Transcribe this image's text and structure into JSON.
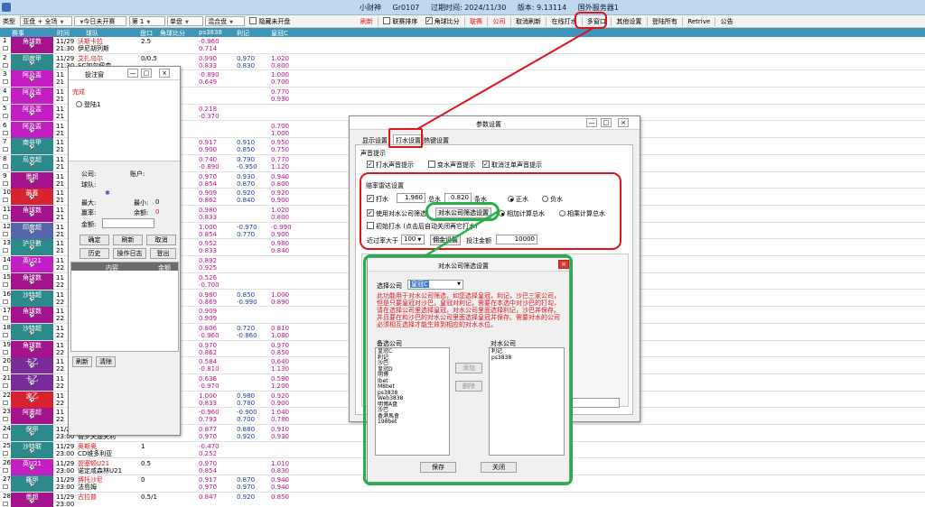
{
  "titlebar": {
    "app": "小财神",
    "user": "Gr0107",
    "expire": "过期时间: 2024/11/30",
    "version": "版本: 9.13114",
    "server": "国外服务器1"
  },
  "toolbar": {
    "type_label": "类型",
    "type_value": "亚盘 + 全场",
    "date_value": "今日未开赛",
    "page_value": "第 1",
    "single_value": "单盘",
    "mixed_value": "混合盘",
    "hide_label": "隐藏未开盘",
    "refresh": "刷新",
    "league_sort": "联赛排序",
    "compare": "角球比分",
    "league": "联赛",
    "company": "公司",
    "cancel_refresh": "取消刷新",
    "online_bet": "在线打水",
    "multi_window": "多窗口",
    "other_settings": "其他设置",
    "login_all": "登陆所有",
    "retrive": "Retrive",
    "notice": "公告"
  },
  "grid": {
    "headers": [
      "赛事",
      "时间",
      "球队",
      "盘口",
      "角球比分",
      "ps3838",
      "利记",
      "皇冠C"
    ],
    "rows": [
      {
        "num": "1",
        "league": "角球数",
        "date": "11/29",
        "time": "21:30",
        "team1": "沃斯卡拉",
        "team2": "伊尼胡列斯",
        "hdp": "2.5",
        "ps": [
          "-0.960",
          "0.714"
        ],
        "lj": [
          "",
          ""
        ],
        "hg": [
          "",
          ""
        ],
        "color": "#a3138c"
      },
      {
        "num": "2",
        "league": "印度甲",
        "date": "11/29",
        "time": "21:30",
        "team1": "艾扎乌尔",
        "team2": "SC加尔佩森",
        "hdp": "0/0.5",
        "ps": [
          "0.990",
          "0.833"
        ],
        "lj": [
          "0.970",
          "0.830"
        ],
        "hg": [
          "1.020",
          "0.800"
        ],
        "color": "#2d8a8a"
      },
      {
        "num": "3",
        "league": "阿及盃",
        "date": "11",
        "time": "21",
        "team1": "",
        "team2": "",
        "hdp": "",
        "ps": [
          "-0.890",
          "0.649"
        ],
        "lj": [
          "",
          ""
        ],
        "hg": [
          "1.000",
          "0.700"
        ],
        "color": "#c11fc2"
      },
      {
        "num": "4",
        "league": "阿及盃",
        "date": "11",
        "time": "21",
        "team1": "",
        "team2": "",
        "hdp": "",
        "ps": [
          "",
          ""
        ],
        "lj": [
          "",
          ""
        ],
        "hg": [
          "0.770",
          "0.930"
        ],
        "color": "#c11fc2"
      },
      {
        "num": "5",
        "league": "阿及盃",
        "date": "11",
        "time": "21",
        "team1": "",
        "team2": "",
        "hdp": "",
        "ps": [
          "0.218",
          "-0.370"
        ],
        "lj": [
          "",
          ""
        ],
        "hg": [
          "",
          ""
        ],
        "color": "#c11fc2"
      },
      {
        "num": "6",
        "league": "阿及盃",
        "date": "11",
        "time": "21",
        "team1": "",
        "team2": "",
        "hdp": "",
        "ps": [
          "",
          ""
        ],
        "lj": [
          "",
          ""
        ],
        "hg": [
          "0.700",
          "1.000"
        ],
        "color": "#c11fc2"
      },
      {
        "num": "7",
        "league": "南非甲",
        "date": "11",
        "time": "21",
        "team1": "",
        "team2": "",
        "hdp": "",
        "ps": [
          "0.917",
          "0.900"
        ],
        "lj": [
          "0.910",
          "0.850"
        ],
        "hg": [
          "0.950",
          "0.750"
        ],
        "color": "#2d8a8a"
      },
      {
        "num": "8",
        "league": "烏克超",
        "date": "11",
        "time": "21",
        "team1": "",
        "team2": "",
        "hdp": "",
        "ps": [
          "0.740",
          "-0.890"
        ],
        "lj": [
          "0.790",
          "-0.950"
        ],
        "hg": [
          "0.770",
          "1.120"
        ],
        "color": "#2d8a8a"
      },
      {
        "num": "9",
        "league": "墨超",
        "date": "11",
        "time": "21",
        "team1": "",
        "team2": "",
        "hdp": "",
        "ps": [
          "0.970",
          "0.854"
        ],
        "lj": [
          "0.930",
          "0.870"
        ],
        "hg": [
          "0.940",
          "0.800"
        ],
        "color": "#a3138c"
      },
      {
        "num": "10",
        "league": "最養",
        "date": "11",
        "time": "21",
        "team1": "",
        "team2": "",
        "hdp": "",
        "ps": [
          "0.909",
          "0.862"
        ],
        "lj": [
          "0.920",
          "0.840"
        ],
        "hg": [
          "0.920",
          "0.900"
        ],
        "color": "#d6232f"
      },
      {
        "num": "11",
        "league": "角球数",
        "date": "11",
        "time": "21",
        "team1": "",
        "team2": "",
        "hdp": "",
        "ps": [
          "0.980",
          "0.833"
        ],
        "lj": [
          "",
          ""
        ],
        "hg": [
          "1.020",
          "0.800"
        ],
        "color": "#a3138c"
      },
      {
        "num": "12",
        "league": "印度超",
        "date": "11",
        "time": "21",
        "team1": "",
        "team2": "",
        "hdp": "",
        "ps": [
          "1.000",
          "0.854"
        ],
        "lj": [
          "-0.970",
          "0.770"
        ],
        "hg": [
          "-0.990",
          "0.900"
        ],
        "color": "#5566aa"
      },
      {
        "num": "13",
        "league": "沪旦數",
        "date": "11",
        "time": "21",
        "team1": "",
        "team2": "",
        "hdp": "",
        "ps": [
          "0.952",
          "0.833"
        ],
        "lj": [
          "",
          ""
        ],
        "hg": [
          "0.980",
          "0.840"
        ],
        "color": "#2d8a8a"
      },
      {
        "num": "14",
        "league": "英U21",
        "date": "11",
        "time": "22",
        "team1": "",
        "team2": "",
        "hdp": "",
        "ps": [
          "0.892",
          "0.925"
        ],
        "lj": [
          "",
          ""
        ],
        "hg": [
          "",
          ""
        ],
        "color": "#c11fc2"
      },
      {
        "num": "15",
        "league": "角球数",
        "date": "11",
        "time": "22",
        "team1": "",
        "team2": "",
        "hdp": "",
        "ps": [
          "0.526",
          "-0.700"
        ],
        "lj": [
          "",
          ""
        ],
        "hg": [
          "",
          ""
        ],
        "color": "#a3138c"
      },
      {
        "num": "16",
        "league": "沙特超",
        "date": "11",
        "time": "22",
        "team1": "",
        "team2": "",
        "hdp": "",
        "ps": [
          "0.980",
          "0.869"
        ],
        "lj": [
          "0.850",
          "-0.990"
        ],
        "hg": [
          "1.000",
          "0.890"
        ],
        "color": "#2d8a8a"
      },
      {
        "num": "17",
        "league": "角球数",
        "date": "11",
        "time": "22",
        "team1": "",
        "team2": "",
        "hdp": "",
        "ps": [
          "0.909",
          "0.909"
        ],
        "lj": [
          "",
          ""
        ],
        "hg": [
          "",
          ""
        ],
        "color": "#a3138c"
      },
      {
        "num": "18",
        "league": "沙特超",
        "date": "11",
        "time": "22",
        "team1": "",
        "team2": "",
        "hdp": "",
        "ps": [
          "0.806",
          "-0.960"
        ],
        "lj": [
          "0.720",
          "-0.860"
        ],
        "hg": [
          "0.810",
          "1.080"
        ],
        "color": "#2d8a8a"
      },
      {
        "num": "19",
        "league": "角球数",
        "date": "11",
        "time": "22",
        "team1": "",
        "team2": "",
        "hdp": "",
        "ps": [
          "0.970",
          "0.862"
        ],
        "lj": [
          "",
          ""
        ],
        "hg": [
          "0.970",
          "0.850"
        ],
        "color": "#a3138c"
      },
      {
        "num": "20",
        "league": "卡乙",
        "date": "11",
        "time": "22",
        "team1": "",
        "team2": "",
        "hdp": "",
        "ps": [
          "0.584",
          "-0.810"
        ],
        "lj": [
          "",
          ""
        ],
        "hg": [
          "0.640",
          "1.130"
        ],
        "color": "#7a2b9a"
      },
      {
        "num": "21",
        "league": "卡乙",
        "date": "11",
        "time": "22",
        "team1": "",
        "team2": "",
        "hdp": "",
        "ps": [
          "0.636",
          "-0.970"
        ],
        "lj": [
          "",
          ""
        ],
        "hg": [
          "0.590",
          "1.200"
        ],
        "color": "#7a2b9a"
      },
      {
        "num": "22",
        "league": "波乙",
        "date": "11",
        "time": "22",
        "team1": "",
        "team2": "",
        "hdp": "",
        "ps": [
          "1.000",
          "0.833"
        ],
        "lj": [
          "0.980",
          "0.780"
        ],
        "hg": [
          "0.920",
          "0.900"
        ],
        "color": "#d6232f"
      },
      {
        "num": "23",
        "league": "阿塞超",
        "date": "11",
        "time": "22",
        "team1": "",
        "team2": "",
        "hdp": "",
        "ps": [
          "-0.960",
          "0.793"
        ],
        "lj": [
          "-0.900",
          "0.700"
        ],
        "hg": [
          "1.040",
          "0.780"
        ],
        "color": "#a3138c"
      },
      {
        "num": "24",
        "league": "保甲",
        "date": "11/29",
        "time": "23:00",
        "team1": "普普特梦甚",
        "team2": "普罗夫迪夫利",
        "hdp": "1",
        "ps": [
          "0.877",
          "0.970"
        ],
        "lj": [
          "0.880",
          "0.920"
        ],
        "hg": [
          "0.910",
          "0.930"
        ],
        "color": "#2d8a8a"
      },
      {
        "num": "25",
        "league": "沙特联",
        "date": "11/29",
        "time": "23:00",
        "team1": "奥斯奥",
        "team2": "CD维多利亚",
        "hdp": "1",
        "ps": [
          "-0.470",
          "0.252"
        ],
        "lj": [
          "",
          ""
        ],
        "hg": [
          "",
          ""
        ],
        "color": "#2d8a8a"
      },
      {
        "num": "26",
        "league": "英U21",
        "date": "11/29",
        "time": "23:00",
        "team1": "盟塞顿U21",
        "team2": "诺定咸森林U21",
        "hdp": "0.5",
        "ps": [
          "0.970",
          "0.854"
        ],
        "lj": [
          "",
          ""
        ],
        "hg": [
          "1.010",
          "0.830"
        ],
        "color": "#c11fc2"
      },
      {
        "num": "27",
        "league": "羅甲",
        "date": "11/29",
        "time": "23:00",
        "team1": "博托沙尼",
        "team2": "法島姆",
        "hdp": "0",
        "ps": [
          "0.917",
          "0.970"
        ],
        "lj": [
          "0.870",
          "0.970"
        ],
        "hg": [
          "0.940",
          "0.940"
        ],
        "color": "#2d8a8a"
      },
      {
        "num": "28",
        "league": "墨超",
        "date": "11/29",
        "time": "23:00",
        "team1": "古拉普",
        "team2": "",
        "hdp": "0.5/1",
        "ps": [
          "0.847",
          ""
        ],
        "lj": [
          "0.920",
          ""
        ],
        "hg": [
          "0.850",
          ""
        ],
        "color": "#a3138c"
      }
    ]
  },
  "bet_window": {
    "title": "投注窗",
    "status": "完成",
    "radio_label": "登陆1",
    "company": "公司:",
    "account": "账户:",
    "team": "球队:",
    "max": "最大:",
    "min": "最小:",
    "min_val": "0",
    "win": "赢率:",
    "balance": "余额:",
    "balance_val": "0",
    "amount": "金额:",
    "btn_ok": "确定",
    "btn_refresh": "刷新",
    "btn_cancel": "取消",
    "btn_history": "历史",
    "btn_log": "操作日志",
    "btn_logout": "登出",
    "col_content": "内容",
    "col_amount": "金额",
    "btn_refresh2": "刷新",
    "btn_clear": "清除"
  },
  "settings_window": {
    "title": "参数设置",
    "tabs": [
      "显示设置",
      "打水设置",
      "热键设置"
    ],
    "sound_group": "声音提示",
    "sound1": "打水声音提示",
    "sound2": "变水声音提示",
    "sound3": "取消注单声音提示",
    "radar_group": "赔率雷达设置",
    "water_label": "打水",
    "water_val": "1.960",
    "total_label": "总水",
    "total_val": "0.820",
    "count_label": "条水",
    "positive": "正水",
    "negative": "负水",
    "use_filter": "使用对水公司筛选",
    "filter_btn": "对水公司筛选设置",
    "compare_total": "相加计算总水",
    "multiply_total": "相乘计算总水",
    "initial_water": "初始打水 (点击后自动关闭再它打水)",
    "near_label": "近过率大于",
    "near_val": "100",
    "bet_setting": "佣金设置",
    "bet_amount": "投注金额",
    "bet_amount_val": "10000"
  },
  "filter_window": {
    "title": "对水公司筛选设置",
    "select_label": "选择公司",
    "select_val": "皇冠C",
    "description": "此功能用于对水公司筛选，如您选择皇冠，利记，沙巴三家公司，但是只要皇冠对沙巴，皇冠对利记，需要在本选中对沙巴的打勾，请在选择公司里选择皇冠，对水公司里面选择利记，沙巴并保存。并且要在和沙巴的对水公司里面选择皇冠并保存。需要对水的公司必须相互选择才能生效到相应的对水水位。",
    "left_label": "备选公司",
    "right_label": "对水公司",
    "left_items": [
      "皇冠C",
      "利记",
      "沙巴",
      "皇冠D",
      "明博",
      "Ibet",
      "M8bet",
      "ps3838",
      "Web3838",
      "明博A盘",
      "沙巴",
      "香港馬會",
      "198bet"
    ],
    "right_items": [
      "利记",
      "ps3838"
    ],
    "btn_add": "添加",
    "btn_delete": "删除",
    "btn_save": "保存",
    "btn_close": "关闭"
  },
  "colors": {
    "header_bg": "#3e94b9",
    "highlight_red": "#e0141c",
    "highlight_green": "#27b04a"
  }
}
